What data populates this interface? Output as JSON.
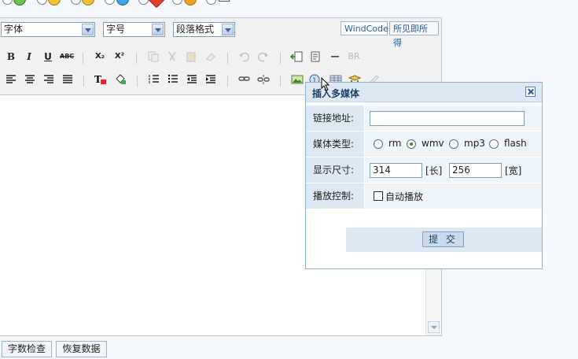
{
  "editor": {
    "font_select": "字体",
    "size_select": "字号",
    "format_select": "段落格式",
    "mode_tabs": [
      "WindCode",
      "所见即所得"
    ],
    "toolbar_row1": {
      "bold": "B",
      "italic": "I",
      "underline": "U",
      "strike": "ABC",
      "subscript": "X₂",
      "superscript": "X²",
      "hr": "—",
      "br": "BR"
    }
  },
  "popup": {
    "title": "插入多媒体",
    "link_label": "链接地址:",
    "link_value": "",
    "type_label": "媒体类型:",
    "type_options": [
      "rm",
      "wmv",
      "mp3",
      "flash"
    ],
    "type_selected": "wmv",
    "size_label": "显示尺寸:",
    "width_value": "314",
    "width_unit": "[长]",
    "height_value": "256",
    "height_unit": "[宽]",
    "control_label": "播放控制:",
    "autoplay_label": "自动播放",
    "autoplay_checked": false,
    "submit_label": "提 交"
  },
  "bottom": {
    "wordcount_label": "字数检查",
    "restore_label": "恢复数据"
  }
}
